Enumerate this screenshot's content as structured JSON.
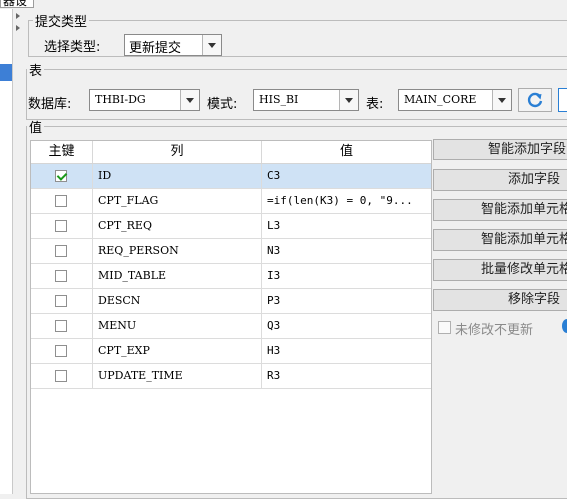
{
  "top_tab": {
    "label": "器设置"
  },
  "submit_type": {
    "legend": "提交类型",
    "select_label": "选择类型:",
    "selected": "更新提交"
  },
  "table_group": {
    "legend": "表",
    "db_label": "数据库:",
    "db_value": "THBI-DG",
    "schema_label": "模式:",
    "schema_value": "HIS_BI",
    "table_label": "表:",
    "table_value": "MAIN_CORE",
    "refresh_icon": "refresh-icon"
  },
  "values_group": {
    "legend": "值",
    "columns": [
      "主键",
      "列",
      "值"
    ],
    "rows": [
      {
        "key": true,
        "col": "ID",
        "val": "C3"
      },
      {
        "key": false,
        "col": "CPT_FLAG",
        "val": "=if(len(K3) = 0, \"9..."
      },
      {
        "key": false,
        "col": "CPT_REQ",
        "val": "L3"
      },
      {
        "key": false,
        "col": "REQ_PERSON",
        "val": "N3"
      },
      {
        "key": false,
        "col": "MID_TABLE",
        "val": "I3"
      },
      {
        "key": false,
        "col": "DESCN",
        "val": "P3"
      },
      {
        "key": false,
        "col": "MENU",
        "val": "Q3"
      },
      {
        "key": false,
        "col": "CPT_EXP",
        "val": "H3"
      },
      {
        "key": false,
        "col": "UPDATE_TIME",
        "val": "R3"
      }
    ]
  },
  "side_buttons": {
    "smart_add_field": "智能添加字段",
    "add_field": "添加字段",
    "smart_add_cell": "智能添加单元格",
    "smart_add_cell2": "智能添加单元格",
    "batch_modify_cell": "批量修改单元格",
    "remove_field": "移除字段",
    "no_update_label": "未修改不更新"
  },
  "colors": {
    "accent": "#3d7fd6",
    "selected_row": "#cfe2f5",
    "check": "#1a9a1a",
    "refresh": "#2a7fd4"
  }
}
